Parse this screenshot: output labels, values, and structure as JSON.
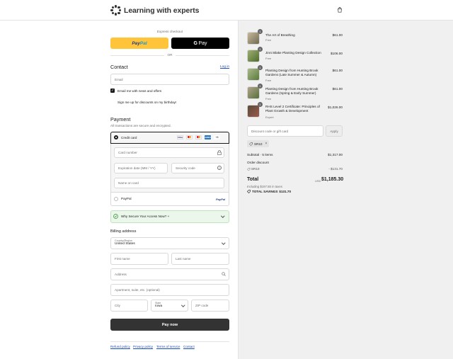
{
  "header": {
    "brand": "Learning with experts",
    "cart_icon": "shopping-bag-icon"
  },
  "express": {
    "label": "Express checkout",
    "paypal_label_1": "Pay",
    "paypal_label_2": "Pal",
    "gpay_label_g": "G",
    "gpay_label": "Pay",
    "or": "OR"
  },
  "contact": {
    "title": "Contact",
    "login": "Log in",
    "email_placeholder": "Email",
    "news_label": "Email me with news and offers",
    "news_checked": true,
    "birthday_label": "Sign me up for discounts on my birthday!",
    "birthday_checked": false
  },
  "payment": {
    "title": "Payment",
    "subtitle": "All transactions are secure and encrypted.",
    "credit_card_label": "Credit card",
    "card_brands": [
      "VISA",
      "MC",
      "MC",
      "AMEX",
      "+8"
    ],
    "card_number_placeholder": "Card number",
    "expiry_placeholder": "Expiration date (MM / YY)",
    "security_placeholder": "Security code",
    "name_placeholder": "Name on card",
    "paypal_label": "PayPal",
    "paypal_logo": "PayPal",
    "secure_access": "Why Secure Your Access Now? +"
  },
  "billing": {
    "title": "Billing address",
    "country_label": "Country/Region",
    "country_value": "United States",
    "first_name": "First name",
    "last_name": "Last name",
    "address": "Address",
    "apartment": "Apartment, suite, etc. (optional)",
    "city": "City",
    "state_label": "State",
    "state_value": "Iowa",
    "zip": "ZIP code"
  },
  "pay_now": "Pay now",
  "footer": [
    "Refund policy",
    "Privacy policy",
    "Terms of service",
    "Contact"
  ],
  "order": {
    "items": [
      {
        "qty": "1",
        "name": "The Art of Breathing",
        "sub": "Free",
        "price": "$61.00"
      },
      {
        "qty": "1",
        "name": "Jinni Blake Planting Design Collection",
        "sub": "Free",
        "price": "$106.00"
      },
      {
        "qty": "1",
        "name": "Planting Design from Hunting Brook Gardens (Late Summer & Autumn)",
        "sub": "Free",
        "price": "$61.00"
      },
      {
        "qty": "1",
        "name": "Planting Design from Hunting Brook Gardens (Spring & Early Summer)",
        "sub": "Free",
        "price": "$61.00"
      },
      {
        "qty": "1",
        "name": "RHS Level 2 Certificate: Principles of Plant Growth & Development",
        "sub": "Expert",
        "price": "$1,026.00"
      }
    ],
    "discount_placeholder": "Discount code or gift card",
    "apply": "Apply",
    "code_tag": "SR10",
    "subtotal_label": "Subtotal · 5 items",
    "subtotal_value": "$1,317.00",
    "order_discount_label": "Order discount",
    "discount_code": "SR10",
    "discount_value": "- $131.70",
    "total_label": "Total",
    "currency": "USD",
    "total_value": "$1,185.30",
    "taxes_note": "Including $197.55 in taxes",
    "savings_label": "TOTAL SAVINGS",
    "savings_value": "$131.70"
  },
  "colors": {
    "paypal_yellow": "#ffc439",
    "link_blue": "#1f4fbf",
    "pay_button": "#333333",
    "secure_green": "#eaf7ea"
  }
}
